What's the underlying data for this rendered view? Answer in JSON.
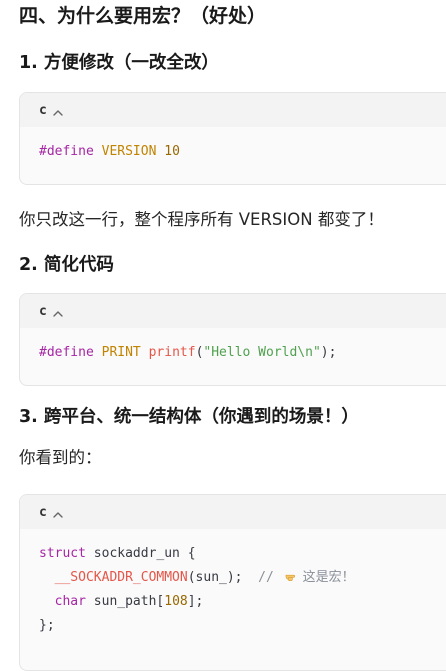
{
  "section_title": "四、为什么要用宏？（好处）",
  "sub1": {
    "title": "1. 方便修改（一改全改）",
    "code": {
      "lang": "c",
      "line1": {
        "directive": "#define",
        "name": "VERSION",
        "value": "10"
      }
    },
    "note": "你只改这一行，整个程序所有 VERSION 都变了！"
  },
  "sub2": {
    "title": "2. 简化代码",
    "code": {
      "lang": "c",
      "line1": {
        "directive": "#define",
        "name": "PRINT",
        "fn": "printf",
        "open": "(",
        "str": "\"Hello World\\n\"",
        "close": ");"
      }
    }
  },
  "sub3": {
    "title": "3. 跨平台、统一结构体（你遇到的场景！）",
    "intro": "你看到的：",
    "code": {
      "lang": "c",
      "line1": {
        "kw": "struct",
        "rest": " sockaddr_un {"
      },
      "line2": {
        "indent": "  ",
        "macro": "__SOCKADDR_COMMON",
        "args": "(sun_);",
        "comment_slash": "  // ",
        "comment_text": "这是宏！"
      },
      "line3": {
        "indent": "  ",
        "kw": "char",
        "rest": " sun_path[",
        "num": "108",
        "end": "];"
      },
      "line4": {
        "text": "};"
      }
    }
  },
  "icons": {
    "collapse": "chevron-up-icon",
    "pointer": "pointing-hand-emoji-icon"
  },
  "colors": {
    "code_bg": "#fafafa",
    "header_bg": "#f3f3f3",
    "border": "#e4e4e4",
    "keyword": "#a626a4",
    "macro_name": "#c18401",
    "number": "#986801",
    "function": "#e45649",
    "string": "#50a14f",
    "comment": "#8a8f98"
  }
}
